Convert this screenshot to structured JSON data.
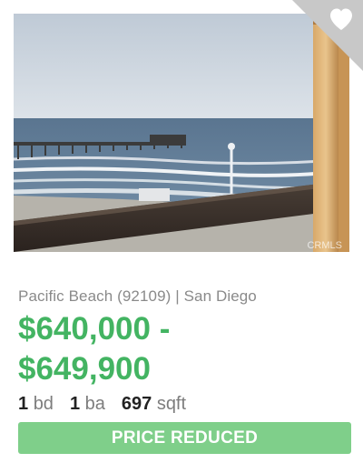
{
  "listing": {
    "location": "Pacific Beach (92109) | San Diego",
    "price_line1": "$640,000 -",
    "price_line2": "$649,900",
    "beds_value": "1",
    "beds_unit": "bd",
    "baths_value": "1",
    "baths_unit": "ba",
    "sqft_value": "697",
    "sqft_unit": "sqft",
    "status_label": "PRICE REDUCED",
    "photo_watermark": "CRMLS"
  },
  "icons": {
    "favorite": "heart-icon"
  },
  "colors": {
    "price": "#43b462",
    "status_button": "#7fcf8a",
    "favorite_corner": "#c8c8c8"
  }
}
